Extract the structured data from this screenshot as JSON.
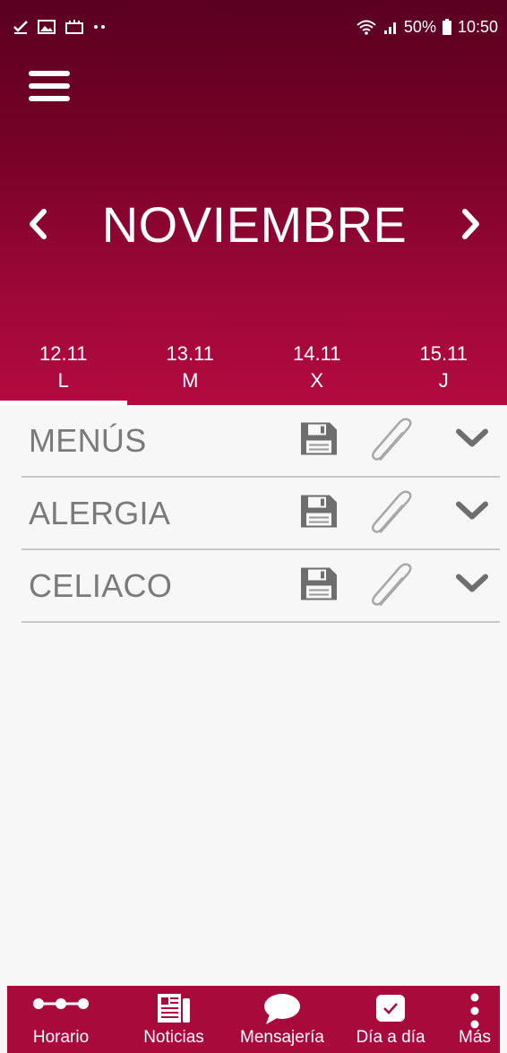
{
  "statusbar": {
    "battery": "50%",
    "time": "10:50"
  },
  "header": {
    "month": "NOVIEMBRE",
    "days": [
      {
        "date": "12.11",
        "letter": "L",
        "active": true
      },
      {
        "date": "13.11",
        "letter": "M",
        "active": false
      },
      {
        "date": "14.11",
        "letter": "X",
        "active": false
      },
      {
        "date": "15.11",
        "letter": "J",
        "active": false
      }
    ]
  },
  "list": {
    "items": [
      {
        "label": "MENÚS"
      },
      {
        "label": "ALERGIA"
      },
      {
        "label": "CELIACO"
      }
    ]
  },
  "bottomnav": {
    "items": [
      {
        "label": "Horario",
        "icon": "timeline-icon"
      },
      {
        "label": "Noticias",
        "icon": "newspaper-icon"
      },
      {
        "label": "Mensajería",
        "icon": "chat-bubble-icon"
      },
      {
        "label": "Día a día",
        "icon": "check-box-icon"
      },
      {
        "label": "Más",
        "icon": "more-vertical-icon"
      }
    ]
  },
  "colors": {
    "primary": "#a80a3c",
    "header_top": "#5a0020",
    "row_text": "#7a7a7a",
    "icon_gray": "#6e6e6e"
  }
}
